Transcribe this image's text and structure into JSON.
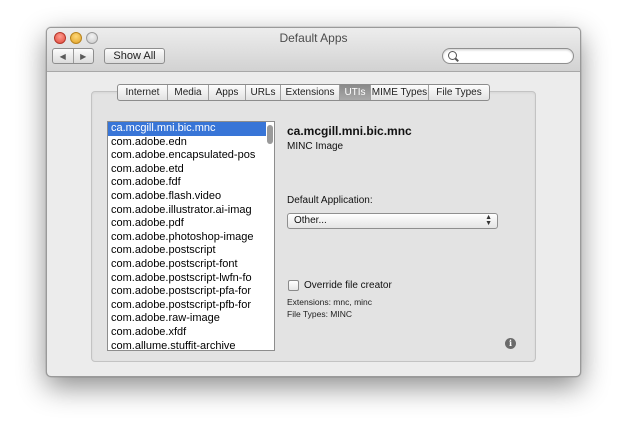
{
  "window": {
    "title": "Default Apps"
  },
  "toolbar": {
    "back_glyph": "◀",
    "forward_glyph": "▶",
    "show_all_label": "Show All",
    "search_value": "",
    "search_placeholder": ""
  },
  "tabs": [
    {
      "label": "Internet",
      "selected": false
    },
    {
      "label": "Media",
      "selected": false
    },
    {
      "label": "Apps",
      "selected": false
    },
    {
      "label": "URLs",
      "selected": false
    },
    {
      "label": "Extensions",
      "selected": false
    },
    {
      "label": "UTIs",
      "selected": true
    },
    {
      "label": "MIME Types",
      "selected": false
    },
    {
      "label": "File Types",
      "selected": false
    }
  ],
  "uti_list": {
    "selected_index": 0,
    "items": [
      "ca.mcgill.mni.bic.mnc",
      "com.adobe.edn",
      "com.adobe.encapsulated-pos",
      "com.adobe.etd",
      "com.adobe.fdf",
      "com.adobe.flash.video",
      "com.adobe.illustrator.ai-imag",
      "com.adobe.pdf",
      "com.adobe.photoshop-image",
      "com.adobe.postscript",
      "com.adobe.postscript-font",
      "com.adobe.postscript-lwfn-fo",
      "com.adobe.postscript-pfa-for",
      "com.adobe.postscript-pfb-for",
      "com.adobe.raw-image",
      "com.adobe.xfdf",
      "com.allume.stuffit-archive"
    ]
  },
  "details": {
    "uti_name": "ca.mcgill.mni.bic.mnc",
    "uti_description": "MINC Image",
    "default_app_label": "Default Application:",
    "default_app_value": "Other...",
    "popup_arrows": "▲▼",
    "override_label": "Override file creator",
    "override_checked": false,
    "extensions_text": "Extensions: mnc, minc",
    "file_types_text": "File Types: MINC",
    "info_glyph": "i"
  },
  "colors": {
    "selection": "#3875d7",
    "window_bg": "#ececec"
  }
}
